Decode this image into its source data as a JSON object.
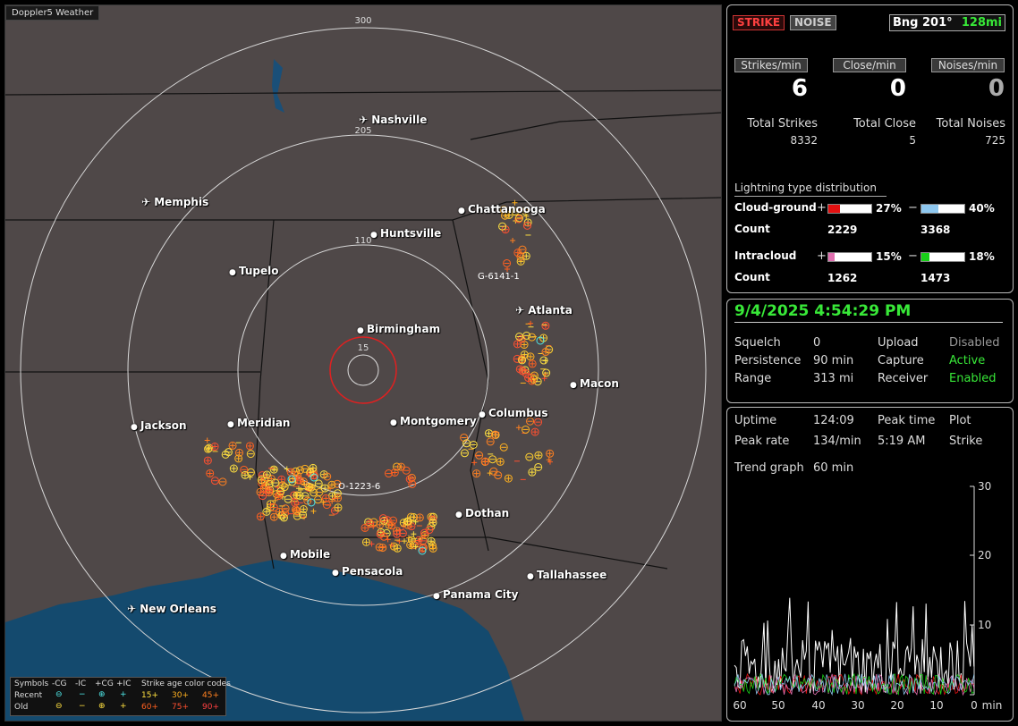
{
  "map": {
    "title": "Doppler5 Weather",
    "ring_labels": [
      "300",
      "205",
      "110",
      "15"
    ],
    "cities": [
      {
        "name": "Nashville",
        "airport": true
      },
      {
        "name": "Memphis",
        "airport": true
      },
      {
        "name": "Chattanooga",
        "airport": false
      },
      {
        "name": "Huntsville",
        "airport": false
      },
      {
        "name": "Tupelo",
        "airport": false
      },
      {
        "name": "Birmingham",
        "airport": false
      },
      {
        "name": "Atlanta",
        "airport": true
      },
      {
        "name": "Macon",
        "airport": false
      },
      {
        "name": "Jackson",
        "airport": false
      },
      {
        "name": "Meridian",
        "airport": false
      },
      {
        "name": "Montgomery",
        "airport": false
      },
      {
        "name": "Columbus",
        "airport": false
      },
      {
        "name": "Dothan",
        "airport": false
      },
      {
        "name": "Mobile",
        "airport": false
      },
      {
        "name": "Pensacola",
        "airport": false
      },
      {
        "name": "Tallahassee",
        "airport": false
      },
      {
        "name": "Panama City",
        "airport": false
      },
      {
        "name": "New Orleans",
        "airport": true
      }
    ],
    "storm_tags": [
      "G-6141-1",
      "O-1223-6"
    ],
    "legend": {
      "symbols_label": "Symbols",
      "cols": [
        "-CG",
        "-IC",
        "+CG",
        "+IC"
      ],
      "recent_label": "Recent",
      "old_label": "Old",
      "age_title": "Strike age color codes",
      "recent_codes": [
        "15+",
        "30+",
        "45+"
      ],
      "old_codes": [
        "60+",
        "75+",
        "90+"
      ]
    }
  },
  "top": {
    "strike_btn": "STRIKE",
    "noise_btn": "NOISE",
    "bearing": "Bng 201°",
    "distance": "128mi",
    "strikes_min_label": "Strikes/min",
    "close_min_label": "Close/min",
    "noises_min_label": "Noises/min",
    "strikes_min": "6",
    "close_min": "0",
    "noises_min": "0",
    "total_strikes_label": "Total Strikes",
    "total_close_label": "Total Close",
    "total_noises_label": "Total Noises",
    "total_strikes": "8332",
    "total_close": "5",
    "total_noises": "725",
    "dist_title": "Lightning type distribution",
    "cg_label": "Cloud-ground",
    "ic_label": "Intracloud",
    "count_label": "Count",
    "plus": "+",
    "minus": "−",
    "cg_pos_pct": "27%",
    "cg_neg_pct": "40%",
    "ic_pos_pct": "15%",
    "ic_neg_pct": "18%",
    "cg_pos_count": "2229",
    "cg_neg_count": "3368",
    "ic_pos_count": "1262",
    "ic_neg_count": "1473",
    "fills": {
      "cg_pos": 0.27,
      "cg_neg": 0.4,
      "ic_pos": 0.15,
      "ic_neg": 0.18
    }
  },
  "status": {
    "datetime": "9/4/2025 4:54:29 PM",
    "squelch_label": "Squelch",
    "squelch": "0",
    "persistence_label": "Persistence",
    "persistence": "90 min",
    "range_label": "Range",
    "range": "313 mi",
    "upload_label": "Upload",
    "upload": "Disabled",
    "capture_label": "Capture",
    "capture": "Active",
    "receiver_label": "Receiver",
    "receiver": "Enabled"
  },
  "trend": {
    "uptime_label": "Uptime",
    "uptime": "124:09",
    "peak_time_label": "Peak time",
    "plot_label": "Plot",
    "peak_rate_label": "Peak rate",
    "peak_rate": "134/min",
    "peak_time": "5:19 AM",
    "plot": "Strike",
    "trend_graph_label": "Trend graph",
    "trend_graph": "60 min",
    "y_ticks": [
      "30",
      "20",
      "10"
    ],
    "x_ticks": [
      "60",
      "50",
      "40",
      "30",
      "20",
      "10",
      "0"
    ],
    "x_unit": "min"
  },
  "colors": {
    "accent_green": "#38e838",
    "strike_red": "#ff3030",
    "bar_red": "#e31010",
    "bar_blue": "#8ec8f0",
    "bar_pink": "#e070b0",
    "bar_green": "#18d018"
  }
}
